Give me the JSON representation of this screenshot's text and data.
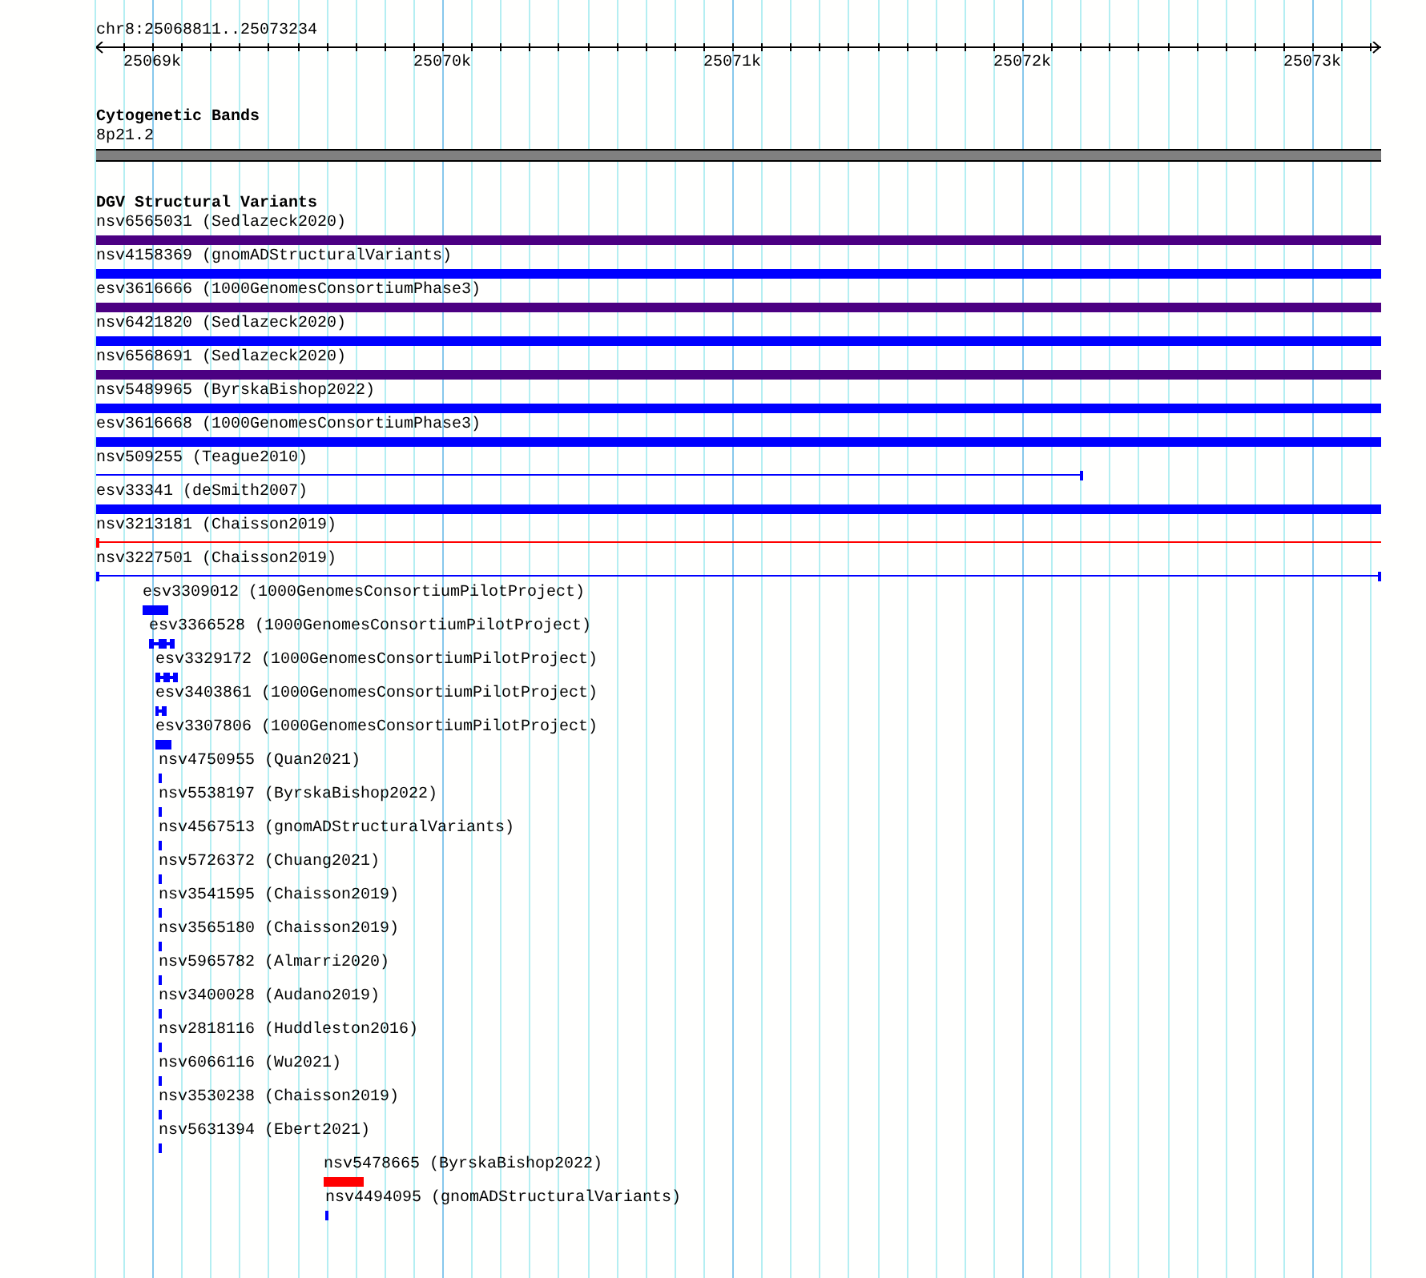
{
  "ruler": {
    "location": "chr8:25068811..25073234",
    "ticks": [
      "25069k",
      "25070k",
      "25071k",
      "25072k",
      "25073k"
    ]
  },
  "tracks": [
    {
      "title": "Cytogenetic Bands",
      "features": [
        {
          "label": "8p21.2",
          "kind": "band",
          "color": "#808080"
        }
      ]
    },
    {
      "title": "DGV Structural Variants",
      "features": [
        {
          "label": "nsv6565031 (Sedlazeck2020)",
          "kind": "bar",
          "color": "#4b0082"
        },
        {
          "label": "nsv4158369 (gnomADStructuralVariants)",
          "kind": "bar",
          "color": "#0000ff"
        },
        {
          "label": "esv3616666 (1000GenomesConsortiumPhase3)",
          "kind": "bar",
          "color": "#4b0082"
        },
        {
          "label": "nsv6421820 (Sedlazeck2020)",
          "kind": "bar",
          "color": "#0000ff"
        },
        {
          "label": "nsv6568691 (Sedlazeck2020)",
          "kind": "bar",
          "color": "#4b0082"
        },
        {
          "label": "nsv5489965 (ByrskaBishop2022)",
          "kind": "bar",
          "color": "#0000ff"
        },
        {
          "label": "esv3616668 (1000GenomesConsortiumPhase3)",
          "kind": "bar",
          "color": "#0000ff"
        },
        {
          "label": "nsv509255 (Teague2010)",
          "kind": "line",
          "color": "#0000ff"
        },
        {
          "label": "esv33341 (deSmith2007)",
          "kind": "bar",
          "color": "#0000ff"
        },
        {
          "label": "nsv3213181 (Chaisson2019)",
          "kind": "line",
          "color": "#ff0000"
        },
        {
          "label": "nsv3227501 (Chaisson2019)",
          "kind": "line",
          "color": "#0000ff"
        },
        {
          "label": "esv3309012 (1000GenomesConsortiumPilotProject)",
          "kind": "bar",
          "color": "#0000ff"
        },
        {
          "label": "esv3366528 (1000GenomesConsortiumPilotProject)",
          "kind": "segmented",
          "color": "#0000ff"
        },
        {
          "label": "esv3329172 (1000GenomesConsortiumPilotProject)",
          "kind": "segmented",
          "color": "#0000ff"
        },
        {
          "label": "esv3403861 (1000GenomesConsortiumPilotProject)",
          "kind": "segmented",
          "color": "#0000ff"
        },
        {
          "label": "esv3307806 (1000GenomesConsortiumPilotProject)",
          "kind": "bar",
          "color": "#0000ff"
        },
        {
          "label": "nsv4750955 (Quan2021)",
          "kind": "bar",
          "color": "#0000ff"
        },
        {
          "label": "nsv5538197 (ByrskaBishop2022)",
          "kind": "bar",
          "color": "#0000ff"
        },
        {
          "label": "nsv4567513 (gnomADStructuralVariants)",
          "kind": "bar",
          "color": "#0000ff"
        },
        {
          "label": "nsv5726372 (Chuang2021)",
          "kind": "bar",
          "color": "#0000ff"
        },
        {
          "label": "nsv3541595 (Chaisson2019)",
          "kind": "bar",
          "color": "#0000ff"
        },
        {
          "label": "nsv3565180 (Chaisson2019)",
          "kind": "bar",
          "color": "#0000ff"
        },
        {
          "label": "nsv5965782 (Almarri2020)",
          "kind": "bar",
          "color": "#0000ff"
        },
        {
          "label": "nsv3400028 (Audano2019)",
          "kind": "bar",
          "color": "#0000ff"
        },
        {
          "label": "nsv2818116 (Huddleston2016)",
          "kind": "bar",
          "color": "#0000ff"
        },
        {
          "label": "nsv6066116 (Wu2021)",
          "kind": "bar",
          "color": "#0000ff"
        },
        {
          "label": "nsv3530238 (Chaisson2019)",
          "kind": "bar",
          "color": "#0000ff"
        },
        {
          "label": "nsv5631394 (Ebert2021)",
          "kind": "bar",
          "color": "#0000ff"
        },
        {
          "label": "nsv5478665 (ByrskaBishop2022)",
          "kind": "bar",
          "color": "#ff0000"
        },
        {
          "label": "nsv4494095 (gnomADStructuralVariants)",
          "kind": "bar",
          "color": "#0000ff"
        }
      ]
    }
  ]
}
